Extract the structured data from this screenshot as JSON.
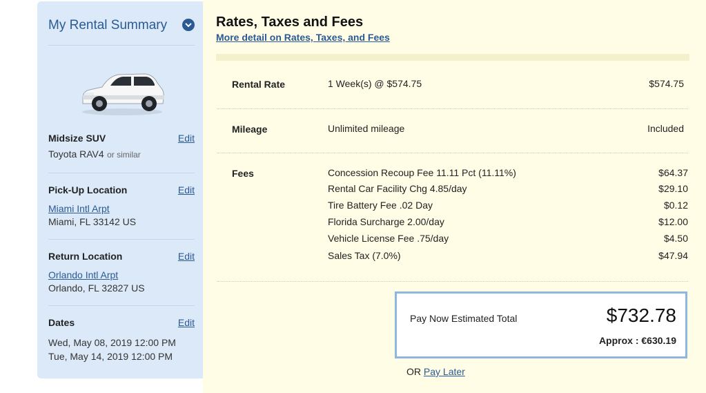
{
  "sidebar": {
    "title": "My Rental Summary",
    "toggle_icon": "chevron-down-icon",
    "car": {
      "class": "Midsize SUV",
      "model": "Toyota RAV4",
      "similar": "or similar",
      "edit": "Edit"
    },
    "pickup": {
      "label": "Pick-Up Location",
      "edit": "Edit",
      "location_link": "Miami Intl Arpt",
      "address": "Miami, FL 33142 US"
    },
    "return": {
      "label": "Return Location",
      "edit": "Edit",
      "location_link": "Orlando Intl Arpt",
      "address": "Orlando, FL 32827 US"
    },
    "dates": {
      "label": "Dates",
      "edit": "Edit",
      "start": "Wed, May 08, 2019 12:00 PM",
      "end": "Tue, May 14, 2019 12:00 PM"
    }
  },
  "main": {
    "title": "Rates, Taxes and Fees",
    "detail_link": "More detail on Rates, Taxes, and Fees",
    "rental_rate": {
      "label": "Rental Rate",
      "desc": "1 Week(s) @ $574.75",
      "amount": "$574.75"
    },
    "mileage": {
      "label": "Mileage",
      "desc": "Unlimited mileage",
      "amount": "Included"
    },
    "fees": {
      "label": "Fees",
      "items": [
        {
          "desc": "Concession Recoup Fee 11.11 Pct (11.11%)",
          "amount": "$64.37"
        },
        {
          "desc": "Rental Car Facility Chg 4.85/day",
          "amount": "$29.10"
        },
        {
          "desc": "Tire Battery Fee .02 Day",
          "amount": "$0.12"
        },
        {
          "desc": "Florida Surcharge 2.00/day",
          "amount": "$12.00"
        },
        {
          "desc": "Vehicle License Fee .75/day",
          "amount": "$4.50"
        },
        {
          "desc": "Sales Tax (7.0%)",
          "amount": "$47.94"
        }
      ]
    },
    "total": {
      "label": "Pay Now Estimated Total",
      "amount": "$732.78",
      "approx": "Approx : €630.19"
    },
    "or_text": "OR",
    "pay_later": "Pay Later"
  },
  "colors": {
    "sidebar_bg": "#dce9f8",
    "main_bg": "#fffde6",
    "link": "#2a5a94",
    "total_border": "#8db6e0"
  }
}
